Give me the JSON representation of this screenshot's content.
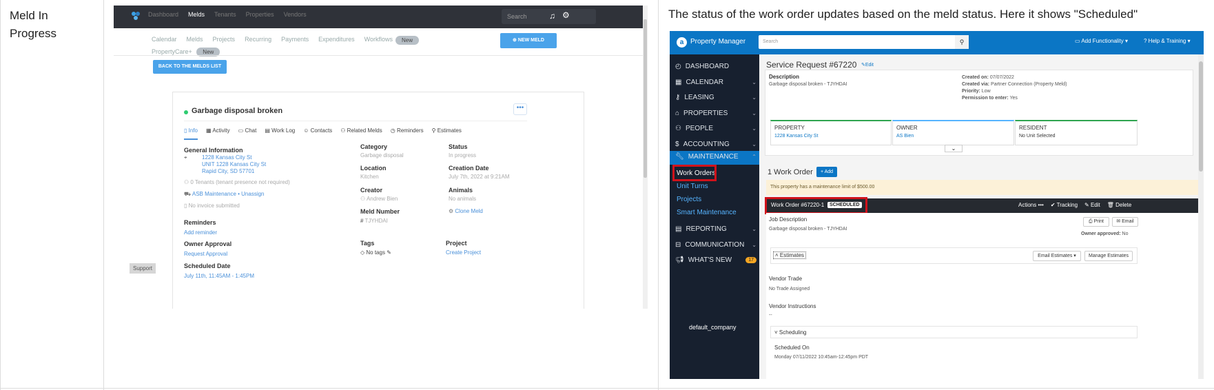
{
  "row": {
    "label": "Meld In Progress",
    "caption": "The status of the work order updates based on the meld status. Here it shows \"Scheduled\""
  },
  "left": {
    "topnav": [
      "Dashboard",
      "Melds",
      "Tenants",
      "Properties",
      "Vendors"
    ],
    "search_placeholder": "Search",
    "subnav": [
      "Calendar",
      "Melds",
      "Projects",
      "Recurring",
      "Payments",
      "Expenditures",
      "Workflows"
    ],
    "new_pill": "New",
    "propertycare": "PropertyCare+",
    "new_meld": "NEW MELD",
    "back_button": "BACK TO THE MELDS LIST",
    "meld_title": "Garbage disposal broken",
    "tabs": [
      "Info",
      "Activity",
      "Chat",
      "Work Log",
      "Contacts",
      "Related Melds",
      "Reminders",
      "Estimates"
    ],
    "general_info": "General Information",
    "address": [
      "1228 Kansas City St",
      "UNIT 1228 Kansas City St",
      "Rapid City, SD 57701"
    ],
    "tenants": "0 Tenants (tenant presence not required)",
    "vendor": "ASB Maintenance",
    "unassign": "Unassign",
    "invoice": "No invoice submitted",
    "reminders_h": "Reminders",
    "add_reminder": "Add reminder",
    "owner_approval_h": "Owner Approval",
    "request_approval": "Request Approval",
    "scheduled_date_h": "Scheduled Date",
    "scheduled_date": "July 11th, 11:45AM - 1:45PM",
    "category_h": "Category",
    "category": "Garbage disposal",
    "status_h": "Status",
    "status": "In progress",
    "location_h": "Location",
    "location": "Kitchen",
    "creation_h": "Creation Date",
    "creation": "July 7th, 2022 at 9:21AM",
    "creator_h": "Creator",
    "creator": "Andrew Bien",
    "animals_h": "Animals",
    "animals": "No animals",
    "meld_number_h": "Meld Number",
    "meld_number": "TJYHDAI",
    "clone": "Clone Meld",
    "tags_h": "Tags",
    "tags": "No tags",
    "project_h": "Project",
    "create_project": "Create Project",
    "support": "Support"
  },
  "right": {
    "brand": "Property Manager",
    "search_placeholder": "Search",
    "add_functionality": "Add Functionality",
    "help": "Help & Training",
    "sidebar": [
      "DASHBOARD",
      "CALENDAR",
      "LEASING",
      "PROPERTIES",
      "PEOPLE",
      "ACCOUNTING",
      "MAINTENANCE"
    ],
    "maint_sub": [
      "Work Orders",
      "Unit Turns",
      "Projects",
      "Smart Maintenance"
    ],
    "sidebar2": [
      "REPORTING",
      "COMMUNICATION",
      "WHAT'S NEW"
    ],
    "whats_new_badge": "17",
    "company": "default_company",
    "sr_title": "Service Request #67220",
    "edit": "Edit",
    "desc_h": "Description",
    "desc": "Garbage disposal broken - TJYHDAI",
    "created_on_k": "Created on:",
    "created_on": "07/07/2022",
    "created_via_k": "Created via:",
    "created_via": "Partner Connection (Property Meld)",
    "priority_k": "Priority:",
    "priority": "Low",
    "permission_k": "Permission to enter:",
    "permission": "Yes",
    "property_h": "PROPERTY",
    "property": "1228 Kansas City St",
    "owner_h": "OWNER",
    "owner": "AS Bien",
    "resident_h": "RESIDENT",
    "resident": "No Unit Selected",
    "work_order_count": "1 Work Order",
    "add": "+ Add",
    "limit_note": "This property has a maintenance limit of $500.00",
    "wo_title": "Work Order #67220-1",
    "wo_status": "SCHEDULED",
    "actions": "Actions",
    "tracking": "Tracking",
    "wo_edit": "Edit",
    "delete": "Delete",
    "job_desc_h": "Job Description",
    "job_desc": "Garbage disposal broken - TJYHDAI",
    "print": "Print",
    "email": "Email",
    "owner_approved_k": "Owner approved:",
    "owner_approved": "No",
    "estimates": "Estimates",
    "email_estimates": "Email Estimates",
    "manage_estimates": "Manage Estimates",
    "vendor_trade_h": "Vendor Trade",
    "vendor_trade": "No Trade Assigned",
    "vendor_instr_h": "Vendor Instructions",
    "vendor_instr": "--",
    "scheduling": "Scheduling",
    "scheduled_on_h": "Scheduled On",
    "scheduled_on": "Monday 07/11/2022 10:45am-12:45pm PDT"
  },
  "colors": {
    "pm_blue": "#0b76c5",
    "highlight_red": "#d0121b",
    "sidebar_dark": "#17202f",
    "meld_topbar": "#2f3239"
  }
}
